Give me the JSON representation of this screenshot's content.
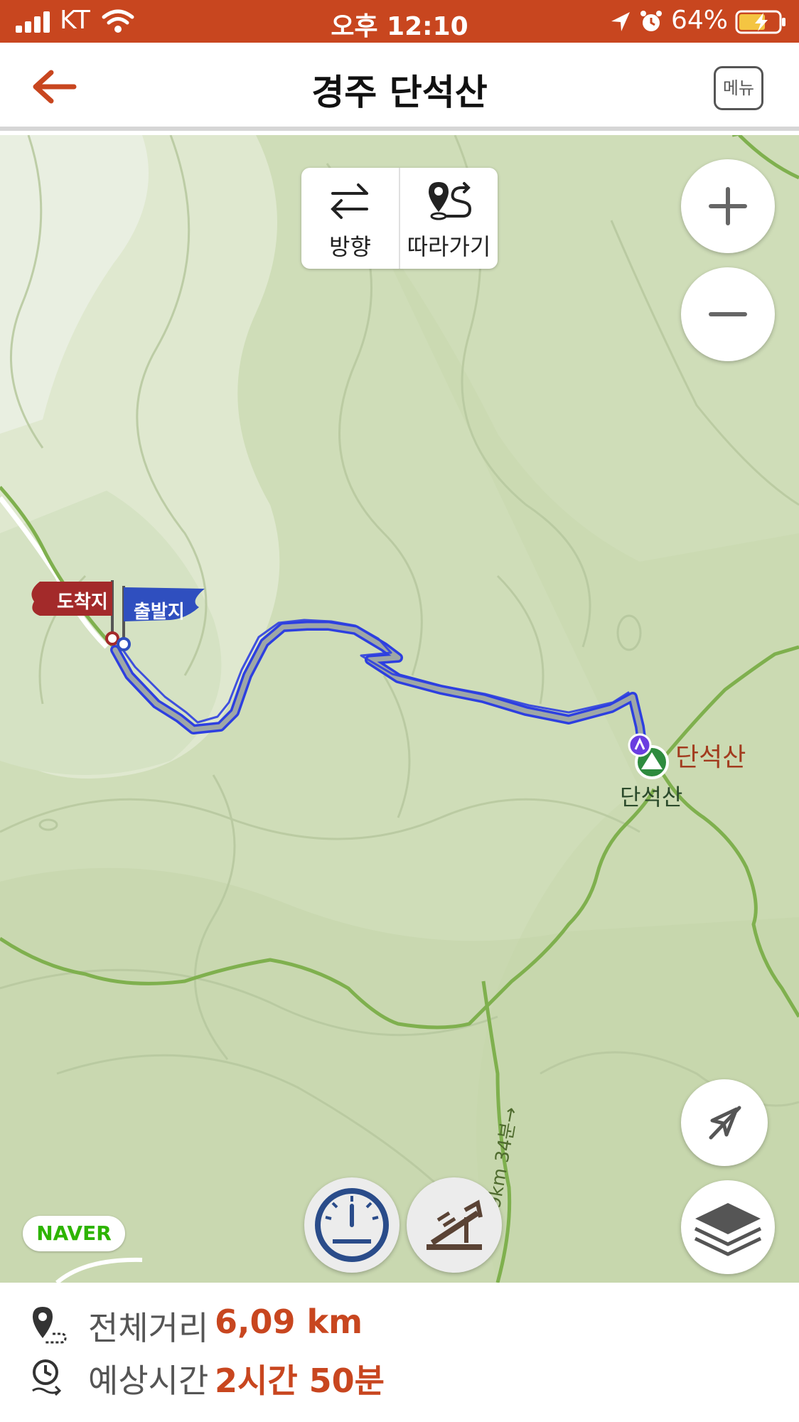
{
  "status_bar": {
    "carrier": "KT",
    "time": "오후 12:10",
    "battery": "64%"
  },
  "header": {
    "title": "경주 단석산",
    "menu_label": "메뉴"
  },
  "map": {
    "direction_panel": {
      "direction_label": "방향",
      "follow_label": "따라가기"
    },
    "route": {
      "arrival_label": "도착지",
      "departure_label": "출발지"
    },
    "peak": {
      "name_label": "단석산",
      "name_label_secondary": "단석산"
    },
    "trail_annotation": "1.9km 34분→",
    "provider": "NAVER"
  },
  "info": {
    "distance_label": "전체거리",
    "distance_value": "6,09 km",
    "time_label": "예상시간",
    "time_value": "2시간 50분"
  },
  "colors": {
    "accent": "#c8461f",
    "route": "#2d3fe0",
    "trail": "#7fb04e",
    "map_bg": "#cfddb8"
  }
}
